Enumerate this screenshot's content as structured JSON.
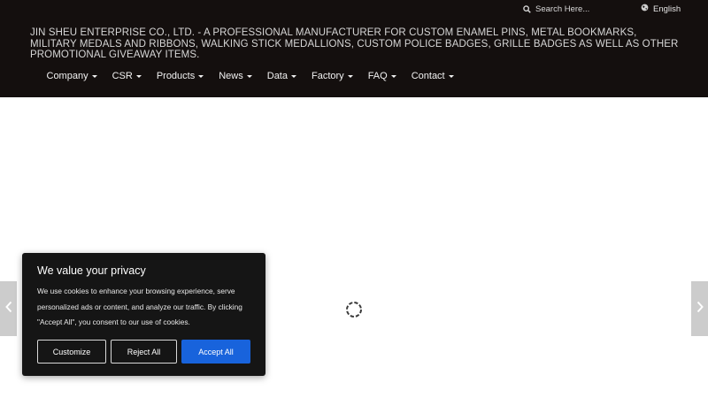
{
  "header": {
    "search": {
      "icon": "search-icon",
      "placeholder": "Search Here..."
    },
    "language": {
      "icon": "globe-icon",
      "label": "English"
    },
    "tagline": "JIN SHEU ENTERPRISE CO., LTD. - A PROFESSIONAL MANUFACTURER FOR CUSTOM ENAMEL PINS, METAL BOOKMARKS, MILITARY MEDALS AND RIBBONS, WALKING STICK MEDALLIONS, CUSTOM POLICE BADGES, GRILLE BADGES AS WELL AS OTHER PROMOTIONAL GIVEAWAY ITEMS."
  },
  "nav": {
    "items": [
      {
        "label": "Company"
      },
      {
        "label": "CSR"
      },
      {
        "label": "Products"
      },
      {
        "label": "News"
      },
      {
        "label": "Data"
      },
      {
        "label": "Factory"
      },
      {
        "label": "FAQ"
      },
      {
        "label": "Contact"
      }
    ]
  },
  "slider": {
    "prev_icon": "chevron-left-icon",
    "next_icon": "chevron-right-icon",
    "loading_icon": "spinner-icon"
  },
  "cookie_banner": {
    "title": "We value your privacy",
    "text": "We use cookies to enhance your browsing experience, serve personalized ads or content, and analyze our traffic. By clicking \"Accept All\", you consent to our use of cookies.",
    "customize_label": "Customize",
    "reject_label": "Reject All",
    "accept_label": "Accept All"
  },
  "colors": {
    "header_bg": "#140f0e",
    "accept_button": "#1863dc",
    "side_arrow_bg": "#cccccc"
  }
}
